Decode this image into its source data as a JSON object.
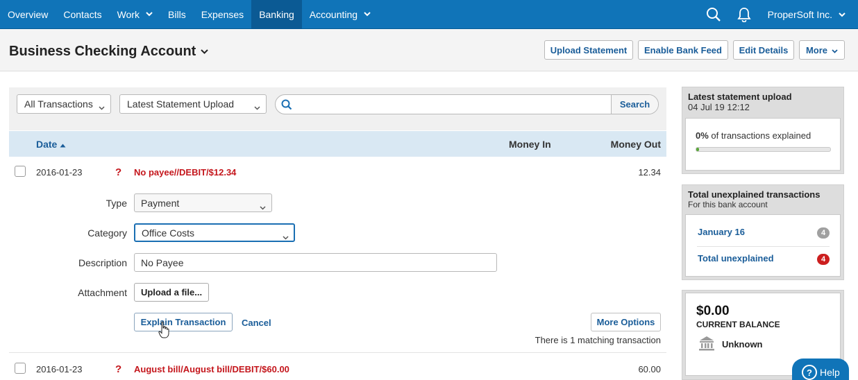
{
  "nav": {
    "items": [
      {
        "label": "Overview"
      },
      {
        "label": "Contacts"
      },
      {
        "label": "Work"
      },
      {
        "label": "Bills"
      },
      {
        "label": "Expenses"
      },
      {
        "label": "Banking"
      },
      {
        "label": "Accounting"
      }
    ],
    "active": "Banking",
    "org_name": "ProperSoft Inc."
  },
  "header": {
    "title": "Business Checking Account",
    "buttons": {
      "upload_statement": "Upload Statement",
      "enable_bank_feed": "Enable Bank Feed",
      "edit_details": "Edit Details",
      "more": "More"
    }
  },
  "filters": {
    "transactions_select": "All Transactions",
    "upload_select": "Latest Statement Upload",
    "search_placeholder": "",
    "search_button": "Search"
  },
  "table": {
    "columns": {
      "date": "Date",
      "money_in": "Money In",
      "money_out": "Money Out"
    },
    "rows": [
      {
        "date": "2016-01-23",
        "flag": "?",
        "description": "No payee//DEBIT/$12.34",
        "money_out": "12.34"
      },
      {
        "date": "2016-01-23",
        "flag": "?",
        "description": "August bill/August bill/DEBIT/$60.00",
        "money_out": "60.00"
      }
    ]
  },
  "explain_form": {
    "type_label": "Type",
    "type_value": "Payment",
    "category_label": "Category",
    "category_value": "Office Costs",
    "description_label": "Description",
    "description_value": "No Payee",
    "attachment_label": "Attachment",
    "upload_button": "Upload a file...",
    "explain_button": "Explain Transaction",
    "cancel_link": "Cancel",
    "more_options_button": "More Options",
    "matching_text": "There is 1 matching transaction"
  },
  "sidebar": {
    "statement": {
      "title": "Latest statement upload",
      "datetime": "04 Jul 19 12:12",
      "percent": "0%",
      "explained_text": "of transactions explained",
      "progress_fraction": 0.02
    },
    "unexplained": {
      "title": "Total unexplained transactions",
      "subtitle": "For this bank account",
      "items": [
        {
          "label": "January 16",
          "count": "4",
          "color": "#a0a0a0"
        },
        {
          "label": "Total unexplained",
          "count": "4",
          "color": "#cc1f1f"
        }
      ]
    },
    "balance": {
      "amount": "$0.00",
      "label": "CURRENT BALANCE",
      "bank_status": "Unknown"
    }
  },
  "help": {
    "label": "Help",
    "glyph": "?"
  },
  "colors": {
    "nav_bg": "#1074b8",
    "nav_active": "#0b5a94",
    "link": "#1a5d99",
    "alert": "#c4161c"
  }
}
